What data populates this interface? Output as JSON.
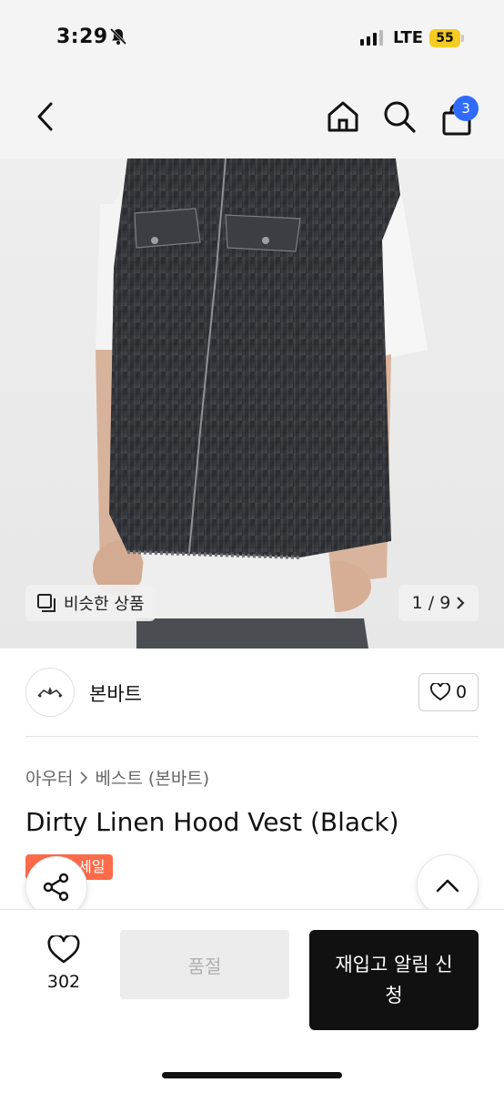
{
  "status_bar": {
    "time": "3:29",
    "network": "LTE",
    "battery": "55"
  },
  "nav": {
    "cart_count": "3"
  },
  "gallery": {
    "similar_label": "비슷한 상품",
    "page_indicator": "1 / 9"
  },
  "brand": {
    "name": "본바트",
    "like_count": "0"
  },
  "product": {
    "breadcrumb": [
      "아우터",
      "베스트 (본바트)"
    ],
    "title": "Dirty Linen Hood Vest (Black)",
    "sale_badge": "세일"
  },
  "bottom": {
    "wish_count": "302",
    "soldout_label": "품절",
    "restock_label": "재입고 알림 신청"
  },
  "colors": {
    "badge_blue": "#2f6bff",
    "sale_orange": "#ff6b4a",
    "cta_black": "#111111"
  }
}
